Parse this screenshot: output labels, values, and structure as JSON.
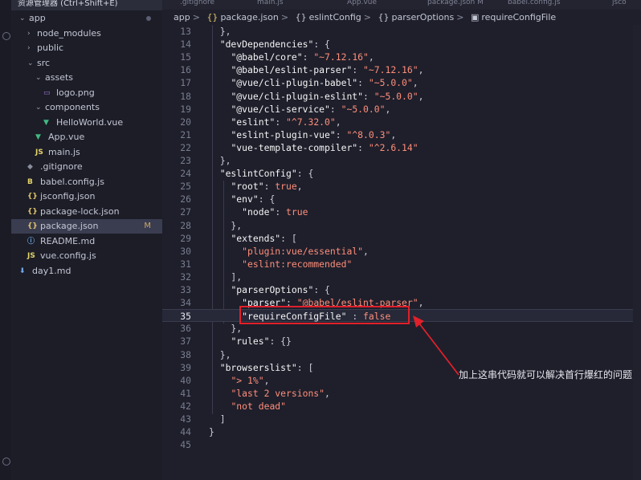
{
  "sidebar": {
    "title": "资源管理器 (Ctrl+Shift+E)",
    "items": [
      {
        "label": "app",
        "chevron": "v",
        "indent": 0,
        "icon": "",
        "status": "dot"
      },
      {
        "label": "node_modules",
        "chevron": ">",
        "indent": 1,
        "icon": ""
      },
      {
        "label": "public",
        "chevron": ">",
        "indent": 1,
        "icon": ""
      },
      {
        "label": "src",
        "chevron": "v",
        "indent": 1,
        "icon": ""
      },
      {
        "label": "assets",
        "chevron": "v",
        "indent": 2,
        "icon": ""
      },
      {
        "label": "logo.png",
        "chevron": "",
        "indent": 3,
        "icon": "image-icon"
      },
      {
        "label": "components",
        "chevron": "v",
        "indent": 2,
        "icon": ""
      },
      {
        "label": "HelloWorld.vue",
        "chevron": "",
        "indent": 3,
        "icon": "vue-icon"
      },
      {
        "label": "App.vue",
        "chevron": "",
        "indent": 2,
        "icon": "vue-icon"
      },
      {
        "label": "main.js",
        "chevron": "",
        "indent": 2,
        "icon": "js-icon"
      },
      {
        "label": ".gitignore",
        "chevron": "",
        "indent": 1,
        "icon": "git-icon"
      },
      {
        "label": "babel.config.js",
        "chevron": "",
        "indent": 1,
        "icon": "babel-icon"
      },
      {
        "label": "jsconfig.json",
        "chevron": "",
        "indent": 1,
        "icon": "json-icon"
      },
      {
        "label": "package-lock.json",
        "chevron": "",
        "indent": 1,
        "icon": "json-icon"
      },
      {
        "label": "package.json",
        "chevron": "",
        "indent": 1,
        "icon": "json-icon",
        "status": "M",
        "selected": true
      },
      {
        "label": "README.md",
        "chevron": "",
        "indent": 1,
        "icon": "info-icon"
      },
      {
        "label": "vue.config.js",
        "chevron": "",
        "indent": 1,
        "icon": "js-icon"
      },
      {
        "label": "day1.md",
        "chevron": "",
        "indent": 0,
        "icon": "markdown-icon"
      }
    ]
  },
  "tabs": [
    ".gitignore",
    "main.js",
    "App.vue",
    "package.json M",
    "babel.config.js",
    "jsco"
  ],
  "breadcrumb": {
    "parts": [
      "app",
      "package.json",
      "eslintConfig",
      "parserOptions",
      "requireConfigFile"
    ]
  },
  "editor": {
    "current_line": 35,
    "lines": [
      {
        "n": 13,
        "tokens": [
          [
            "p",
            "  },"
          ]
        ]
      },
      {
        "n": 14,
        "tokens": [
          [
            "p",
            "  "
          ],
          [
            "k",
            "\"devDependencies\""
          ],
          [
            "p",
            ": {"
          ]
        ]
      },
      {
        "n": 15,
        "tokens": [
          [
            "p",
            "    "
          ],
          [
            "k",
            "\"@babel/core\""
          ],
          [
            "p",
            ": "
          ],
          [
            "s",
            "\"~7.12.16\""
          ],
          [
            "p",
            ","
          ]
        ]
      },
      {
        "n": 16,
        "tokens": [
          [
            "p",
            "    "
          ],
          [
            "k",
            "\"@babel/eslint-parser\""
          ],
          [
            "p",
            ": "
          ],
          [
            "s",
            "\"~7.12.16\""
          ],
          [
            "p",
            ","
          ]
        ]
      },
      {
        "n": 17,
        "tokens": [
          [
            "p",
            "    "
          ],
          [
            "k",
            "\"@vue/cli-plugin-babel\""
          ],
          [
            "p",
            ": "
          ],
          [
            "s",
            "\"~5.0.0\""
          ],
          [
            "p",
            ","
          ]
        ]
      },
      {
        "n": 18,
        "tokens": [
          [
            "p",
            "    "
          ],
          [
            "k",
            "\"@vue/cli-plugin-eslint\""
          ],
          [
            "p",
            ": "
          ],
          [
            "s",
            "\"~5.0.0\""
          ],
          [
            "p",
            ","
          ]
        ]
      },
      {
        "n": 19,
        "tokens": [
          [
            "p",
            "    "
          ],
          [
            "k",
            "\"@vue/cli-service\""
          ],
          [
            "p",
            ": "
          ],
          [
            "s",
            "\"~5.0.0\""
          ],
          [
            "p",
            ","
          ]
        ]
      },
      {
        "n": 20,
        "tokens": [
          [
            "p",
            "    "
          ],
          [
            "k",
            "\"eslint\""
          ],
          [
            "p",
            ": "
          ],
          [
            "s",
            "\"^7.32.0\""
          ],
          [
            "p",
            ","
          ]
        ]
      },
      {
        "n": 21,
        "tokens": [
          [
            "p",
            "    "
          ],
          [
            "k",
            "\"eslint-plugin-vue\""
          ],
          [
            "p",
            ": "
          ],
          [
            "s",
            "\"^8.0.3\""
          ],
          [
            "p",
            ","
          ]
        ]
      },
      {
        "n": 22,
        "tokens": [
          [
            "p",
            "    "
          ],
          [
            "k",
            "\"vue-template-compiler\""
          ],
          [
            "p",
            ": "
          ],
          [
            "s",
            "\"^2.6.14\""
          ]
        ]
      },
      {
        "n": 23,
        "tokens": [
          [
            "p",
            "  },"
          ]
        ]
      },
      {
        "n": 24,
        "tokens": [
          [
            "p",
            "  "
          ],
          [
            "k",
            "\"eslintConfig\""
          ],
          [
            "p",
            ": {"
          ]
        ]
      },
      {
        "n": 25,
        "tokens": [
          [
            "p",
            "    "
          ],
          [
            "k",
            "\"root\""
          ],
          [
            "p",
            ": "
          ],
          [
            "b",
            "true"
          ],
          [
            "p",
            ","
          ]
        ]
      },
      {
        "n": 26,
        "tokens": [
          [
            "p",
            "    "
          ],
          [
            "k",
            "\"env\""
          ],
          [
            "p",
            ": {"
          ]
        ]
      },
      {
        "n": 27,
        "tokens": [
          [
            "p",
            "      "
          ],
          [
            "k",
            "\"node\""
          ],
          [
            "p",
            ": "
          ],
          [
            "b",
            "true"
          ]
        ]
      },
      {
        "n": 28,
        "tokens": [
          [
            "p",
            "    },"
          ]
        ]
      },
      {
        "n": 29,
        "tokens": [
          [
            "p",
            "    "
          ],
          [
            "k",
            "\"extends\""
          ],
          [
            "p",
            ": ["
          ]
        ]
      },
      {
        "n": 30,
        "tokens": [
          [
            "p",
            "      "
          ],
          [
            "s",
            "\"plugin:vue/essential\""
          ],
          [
            "p",
            ","
          ]
        ]
      },
      {
        "n": 31,
        "tokens": [
          [
            "p",
            "      "
          ],
          [
            "s",
            "\"eslint:recommended\""
          ]
        ]
      },
      {
        "n": 32,
        "tokens": [
          [
            "p",
            "    ],"
          ]
        ]
      },
      {
        "n": 33,
        "tokens": [
          [
            "p",
            "    "
          ],
          [
            "k",
            "\"parserOptions\""
          ],
          [
            "p",
            ": {"
          ]
        ]
      },
      {
        "n": 34,
        "tokens": [
          [
            "p",
            "      "
          ],
          [
            "k",
            "\"parser\""
          ],
          [
            "p",
            ": "
          ],
          [
            "s",
            "\"@babel/eslint-parser\""
          ],
          [
            "p",
            ","
          ]
        ]
      },
      {
        "n": 35,
        "tokens": [
          [
            "p",
            "      "
          ],
          [
            "k",
            "\"requireConfigFile\""
          ],
          [
            "p",
            " : "
          ],
          [
            "b",
            "false"
          ]
        ]
      },
      {
        "n": 36,
        "tokens": [
          [
            "p",
            "    },"
          ]
        ]
      },
      {
        "n": 37,
        "tokens": [
          [
            "p",
            "    "
          ],
          [
            "k",
            "\"rules\""
          ],
          [
            "p",
            ": {}"
          ]
        ]
      },
      {
        "n": 38,
        "tokens": [
          [
            "p",
            "  },"
          ]
        ]
      },
      {
        "n": 39,
        "tokens": [
          [
            "p",
            "  "
          ],
          [
            "k",
            "\"browserslist\""
          ],
          [
            "p",
            ": ["
          ]
        ]
      },
      {
        "n": 40,
        "tokens": [
          [
            "p",
            "    "
          ],
          [
            "s",
            "\"> 1%\""
          ],
          [
            "p",
            ","
          ]
        ]
      },
      {
        "n": 41,
        "tokens": [
          [
            "p",
            "    "
          ],
          [
            "s",
            "\"last 2 versions\""
          ],
          [
            "p",
            ","
          ]
        ]
      },
      {
        "n": 42,
        "tokens": [
          [
            "p",
            "    "
          ],
          [
            "s",
            "\"not dead\""
          ]
        ]
      },
      {
        "n": 43,
        "tokens": [
          [
            "p",
            "  ]"
          ]
        ]
      },
      {
        "n": 44,
        "tokens": [
          [
            "p",
            "}"
          ]
        ]
      },
      {
        "n": 45,
        "tokens": []
      }
    ]
  },
  "annotation": {
    "text": "加上这串代码就可以解决首行爆红的问题",
    "box_color": "#e0202a"
  }
}
